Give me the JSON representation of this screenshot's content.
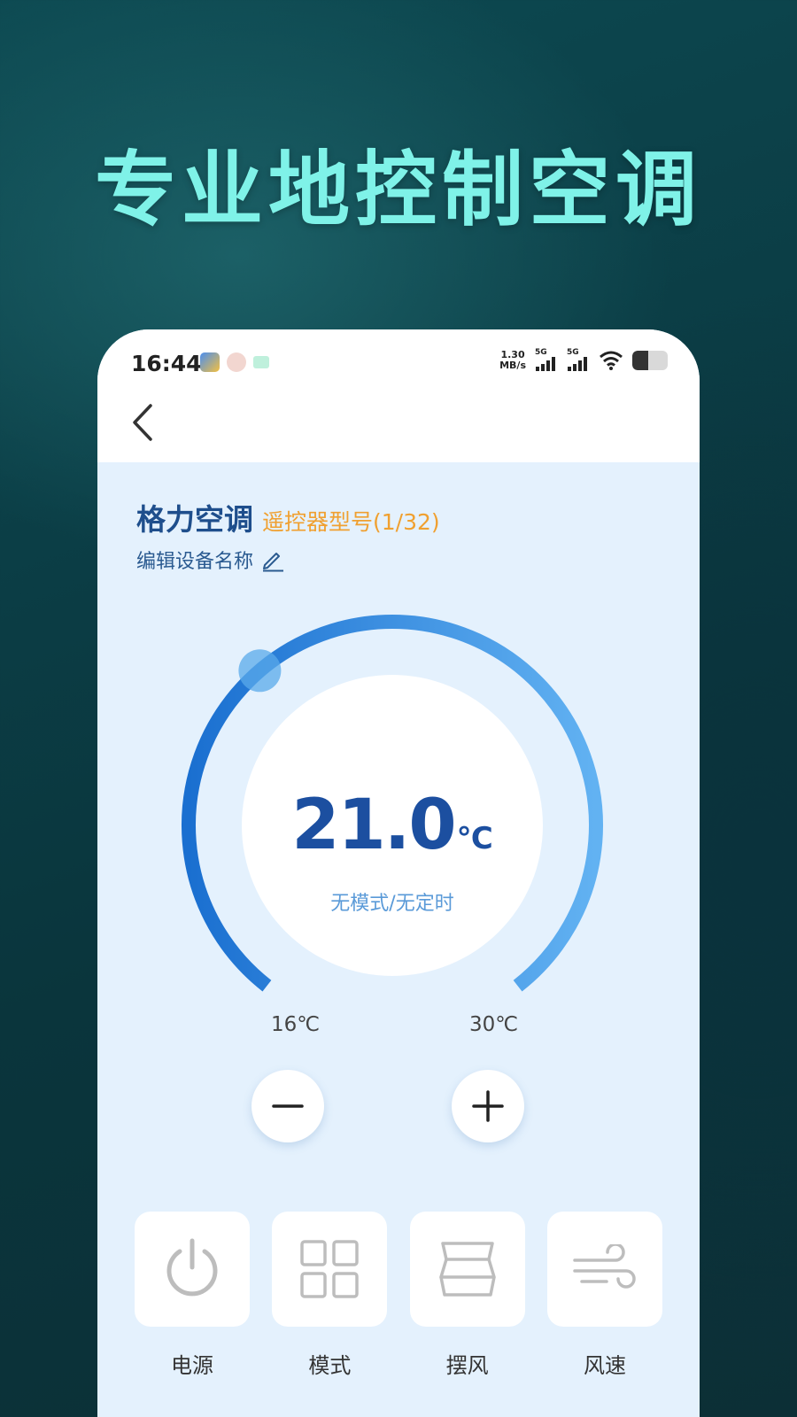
{
  "headline": "专业地控制空调",
  "status_bar": {
    "time": "16:44",
    "net_speed_value": "1.30",
    "net_speed_unit": "MB/s",
    "signal_1": "5G",
    "signal_2": "5G",
    "battery_level": 0.45
  },
  "device": {
    "name": "格力空调",
    "model": "遥控器型号(1/32)",
    "edit_label": "编辑设备名称"
  },
  "thermostat": {
    "temperature": "21.0",
    "unit": "℃",
    "mode_text": "无模式/无定时",
    "min_label": "16℃",
    "max_label": "30℃",
    "min": 16,
    "max": 30,
    "current": 21.0
  },
  "controls": [
    {
      "label": "电源",
      "icon": "power-icon"
    },
    {
      "label": "模式",
      "icon": "mode-grid-icon"
    },
    {
      "label": "摆风",
      "icon": "swing-icon"
    },
    {
      "label": "风速",
      "icon": "wind-speed-icon"
    }
  ],
  "colors": {
    "headline": "#7ff2e8",
    "accent": "#1c4fa0",
    "model_orange": "#f0a030",
    "dial_start": "#1a6fd0",
    "dial_end": "#62b2f2"
  }
}
